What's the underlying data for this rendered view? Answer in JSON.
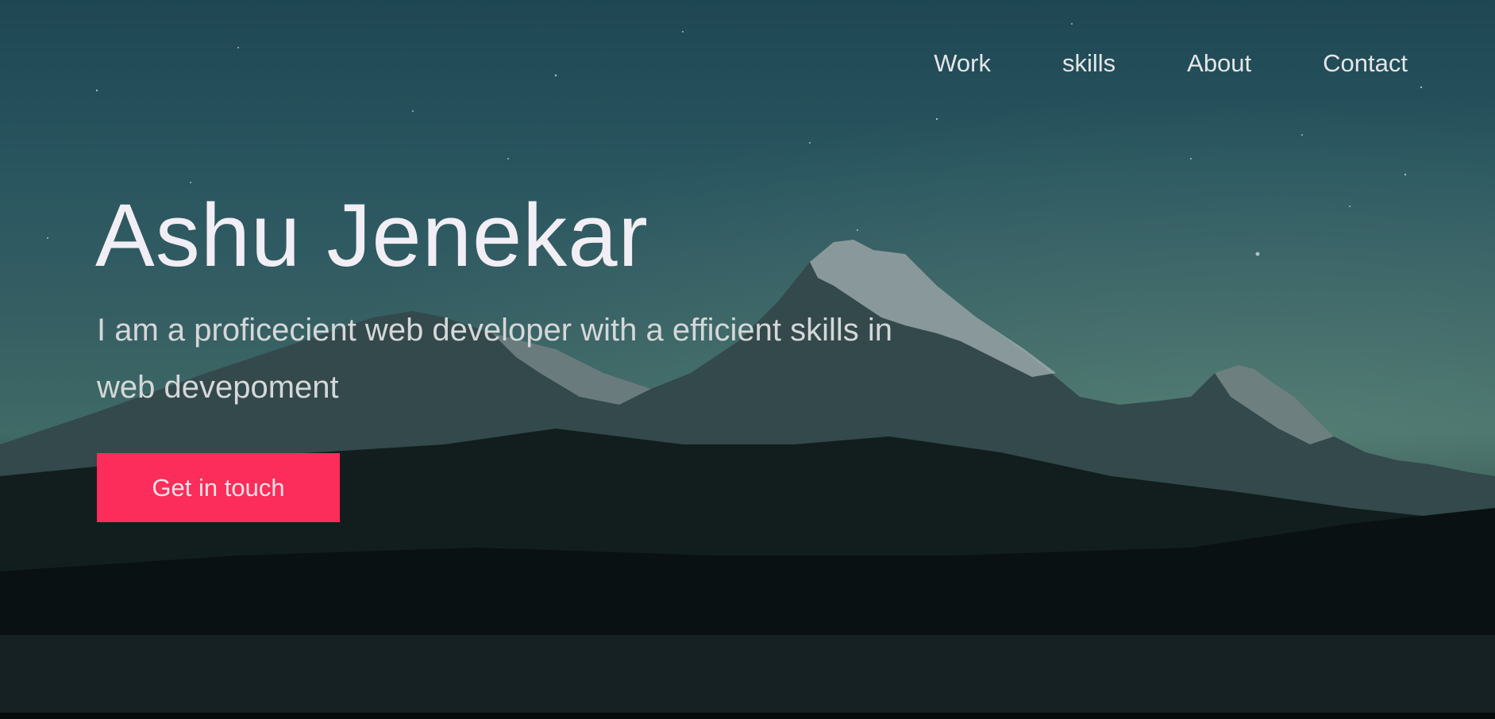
{
  "nav": {
    "items": [
      {
        "label": "Work"
      },
      {
        "label": "skills"
      },
      {
        "label": "About"
      },
      {
        "label": "Contact"
      }
    ]
  },
  "hero": {
    "title": "Ashu Jenekar",
    "tagline": "I am a proficecient web developer with a efficient skills in web devepoment",
    "cta_label": "Get in touch"
  },
  "colors": {
    "accent": "#fc2d5a",
    "sky_top": "#1e4753",
    "sky_mid": "#3f6a66",
    "ground": "#071012",
    "text_primary": "#f2eef5",
    "text_secondary": "#d5d7d9"
  }
}
